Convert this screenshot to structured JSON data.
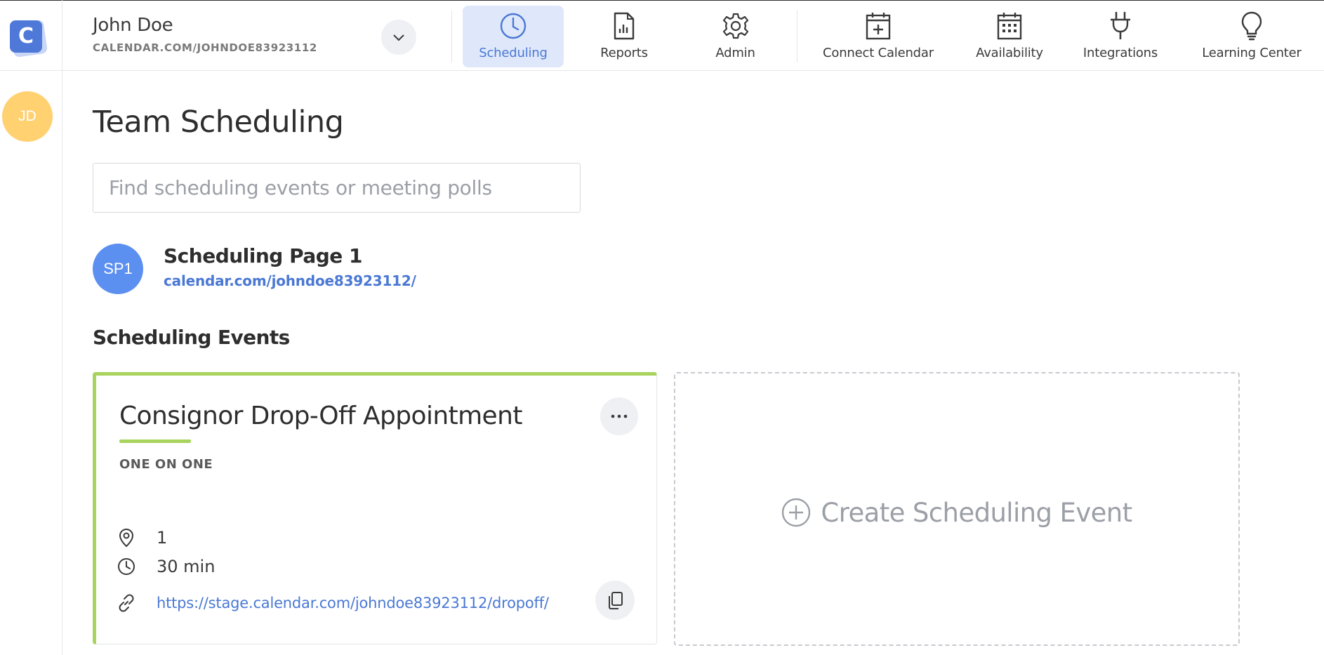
{
  "logo_letter": "C",
  "user": {
    "name": "John Doe",
    "url": "CALENDAR.COM/JOHNDOE83923112",
    "avatar_initials": "JD"
  },
  "nav": {
    "items": [
      {
        "label": "Scheduling",
        "icon": "clock-icon",
        "active": true
      },
      {
        "label": "Reports",
        "icon": "report-icon",
        "active": false
      },
      {
        "label": "Admin",
        "icon": "gear-icon",
        "active": false
      },
      {
        "label": "Connect Calendar",
        "icon": "calendar-plus-icon",
        "active": false
      },
      {
        "label": "Availability",
        "icon": "calendar-grid-icon",
        "active": false
      },
      {
        "label": "Integrations",
        "icon": "plug-icon",
        "active": false
      },
      {
        "label": "Learning Center",
        "icon": "lightbulb-icon",
        "active": false
      }
    ]
  },
  "page": {
    "title": "Team Scheduling",
    "search_placeholder": "Find scheduling events or meeting polls"
  },
  "scheduling_page": {
    "initials": "SP1",
    "title": "Scheduling Page 1",
    "url": "calendar.com/johndoe83923112/"
  },
  "events_section": {
    "title": "Scheduling Events"
  },
  "event_card": {
    "title": "Consignor Drop-Off Appointment",
    "type": "ONE ON ONE",
    "location": "1",
    "duration": "30 min",
    "link": "https://stage.calendar.com/johndoe83923112/dropoff/"
  },
  "create_card": {
    "label": "Create Scheduling Event"
  },
  "colors": {
    "accent": "#4a78d4",
    "active_bg": "#dfe8fb",
    "card_accent": "#a8d45e",
    "user_avatar": "#ffd171",
    "page_avatar": "#5b8ff0"
  }
}
